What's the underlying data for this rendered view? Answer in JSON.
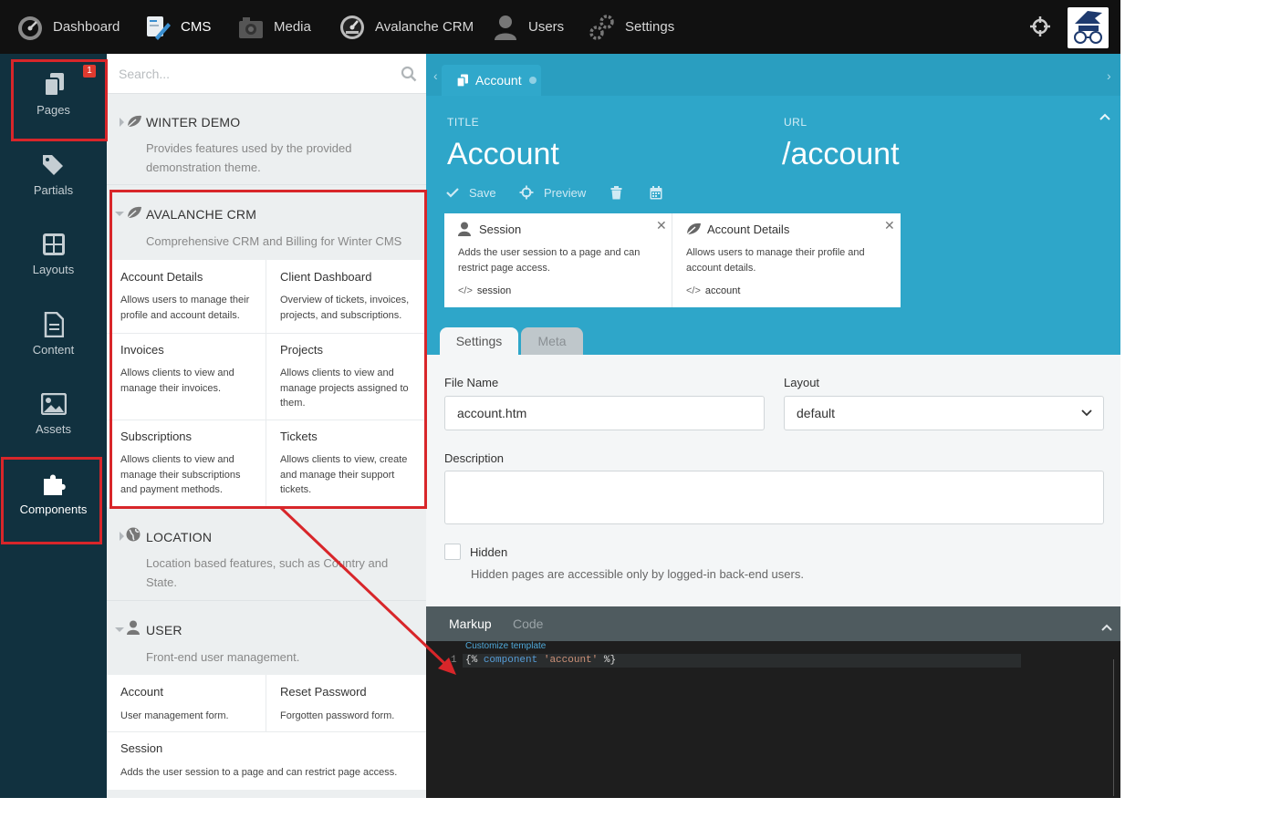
{
  "topnav": {
    "items": [
      {
        "label": "Dashboard",
        "icon": "dashboard-gauge-icon"
      },
      {
        "label": "CMS",
        "icon": "cms-icon"
      },
      {
        "label": "Media",
        "icon": "media-icon"
      },
      {
        "label": "Avalanche CRM",
        "icon": "avalanche-crm-icon"
      },
      {
        "label": "Users",
        "icon": "users-icon"
      },
      {
        "label": "Settings",
        "icon": "settings-icon"
      }
    ],
    "active": "CMS"
  },
  "sidebar": {
    "items": [
      {
        "label": "Pages",
        "icon": "pages-icon",
        "badge": "1"
      },
      {
        "label": "Partials",
        "icon": "partials-tags-icon"
      },
      {
        "label": "Layouts",
        "icon": "layouts-icon"
      },
      {
        "label": "Content",
        "icon": "content-file-icon"
      },
      {
        "label": "Assets",
        "icon": "assets-image-icon"
      },
      {
        "label": "Components",
        "icon": "components-puzzle-icon"
      }
    ],
    "active": "Components"
  },
  "components_panel": {
    "search_placeholder": "Search...",
    "groups": [
      {
        "title": "WINTER DEMO",
        "description": "Provides features used by the provided demonstration theme.",
        "expanded": false,
        "components": []
      },
      {
        "title": "AVALANCHE CRM",
        "description": "Comprehensive CRM and Billing for Winter CMS",
        "expanded": true,
        "components": [
          {
            "name": "Account Details",
            "description": "Allows users to manage their profile and account details."
          },
          {
            "name": "Client Dashboard",
            "description": "Overview of tickets, invoices, projects, and subscriptions."
          },
          {
            "name": "Invoices",
            "description": "Allows clients to view and manage their invoices."
          },
          {
            "name": "Projects",
            "description": "Allows clients to view and manage projects assigned to them."
          },
          {
            "name": "Subscriptions",
            "description": "Allows clients to view and manage their subscriptions and payment methods."
          },
          {
            "name": "Tickets",
            "description": "Allows clients to view, create and manage their support tickets."
          }
        ]
      },
      {
        "title": "LOCATION",
        "description": "Location based features, such as Country and State.",
        "expanded": false,
        "components": []
      },
      {
        "title": "USER",
        "description": "Front-end user management.",
        "expanded": true,
        "components": [
          {
            "name": "Account",
            "description": "User management form."
          },
          {
            "name": "Reset Password",
            "description": "Forgotten password form."
          },
          {
            "name": "Session",
            "description": "Adds the user session to a page and can restrict page access."
          }
        ]
      }
    ]
  },
  "editor": {
    "tab_label": "Account",
    "title_label": "TITLE",
    "title_value": "Account",
    "url_label": "URL",
    "url_value": "/account",
    "toolbar": {
      "save": "Save",
      "preview": "Preview"
    },
    "attached_components": [
      {
        "name": "Session",
        "description": "Adds the user session to a page and can restrict page access.",
        "alias": "session",
        "icon": "user-icon"
      },
      {
        "name": "Account Details",
        "description": "Allows users to manage their profile and account details.",
        "alias": "account",
        "icon": "leaf-icon"
      }
    ],
    "settings_tabs": [
      "Settings",
      "Meta"
    ],
    "form": {
      "file_name_label": "File Name",
      "file_name_value": "account.htm",
      "layout_label": "Layout",
      "layout_value": "default",
      "description_label": "Description",
      "description_value": "",
      "hidden_label": "Hidden",
      "hidden_checked": false,
      "hidden_hint": "Hidden pages are accessible only by logged-in back-end users."
    },
    "code_tabs": [
      "Markup",
      "Code"
    ],
    "customize_template": "Customize template",
    "code": {
      "line_number": "1",
      "open": "{%",
      "keyword": "component",
      "string": "'account'",
      "close": "%}"
    }
  },
  "colors": {
    "nav_bg": "#111111",
    "sidebar_bg": "#11313f",
    "accent_blue": "#2ea6c9",
    "annotation_red": "#d8262a"
  }
}
